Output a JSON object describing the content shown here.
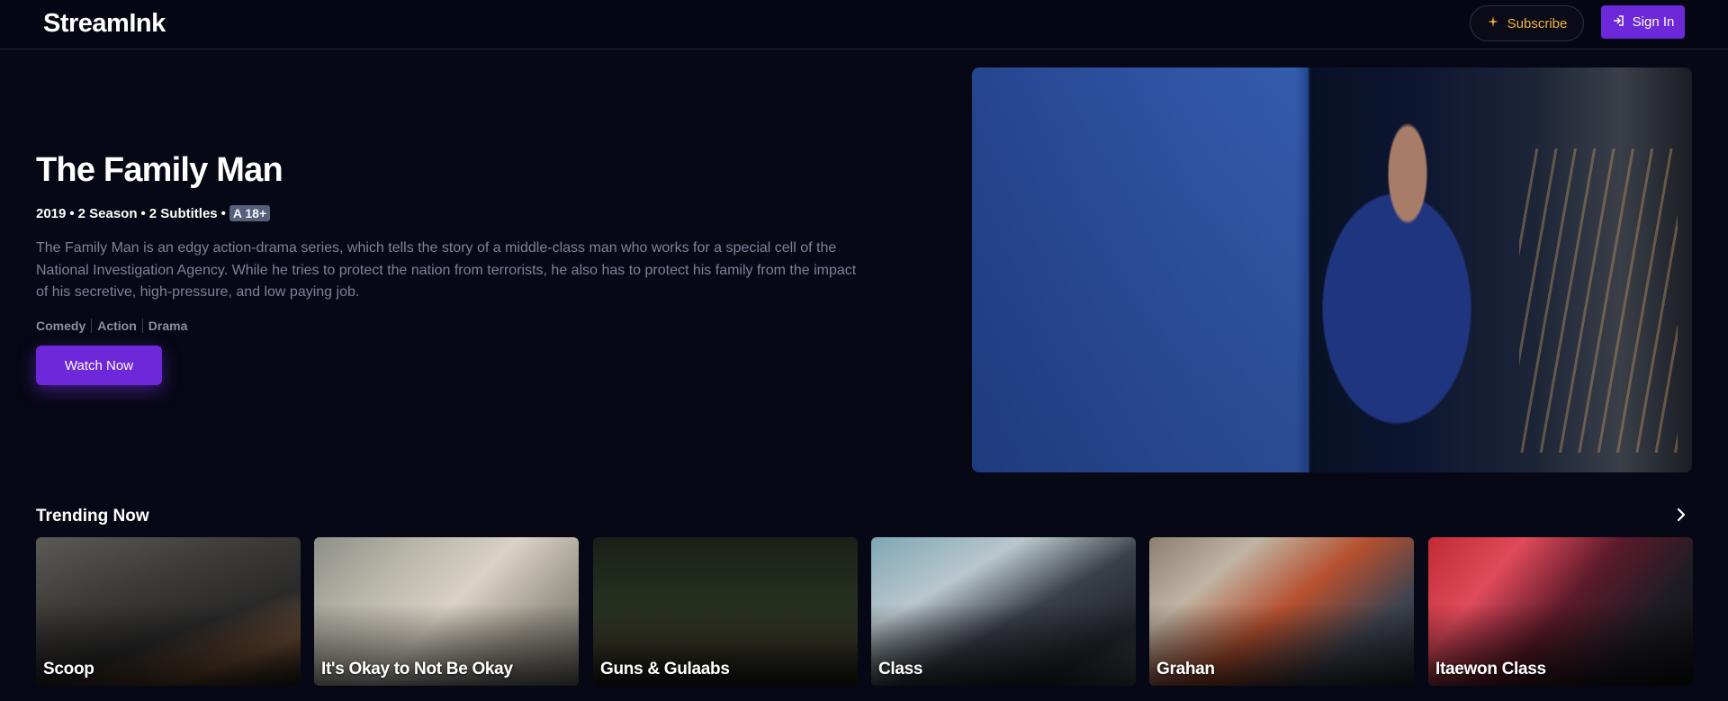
{
  "app": {
    "name": "StreamInk"
  },
  "header": {
    "subscribe_label": "Subscribe",
    "signin_label": "Sign In",
    "subscribe_icon": "sparkle-icon",
    "signin_icon": "sign-in-arrow-icon"
  },
  "hero": {
    "title": "The Family Man",
    "year": "2019",
    "seasons": "2 Season",
    "subtitles": "2 Subtitles",
    "rating": "A 18+",
    "description": "The Family Man is an edgy action-drama series, which tells the story of a middle-class man who works for a special cell of the National Investigation Agency. While he tries to protect the nation from terrorists, he also has to protect his family from the impact of his secretive, high-pressure, and low paying job.",
    "genres": [
      "Comedy",
      "Action",
      "Drama"
    ],
    "watch_label": "Watch Now"
  },
  "trending": {
    "title": "Trending Now",
    "next_icon": "chevron-right-icon",
    "items": [
      {
        "title": "Scoop"
      },
      {
        "title": "It's Okay to Not Be Okay"
      },
      {
        "title": "Guns & Gulaabs"
      },
      {
        "title": "Class"
      },
      {
        "title": "Grahan"
      },
      {
        "title": "Itaewon Class"
      }
    ]
  },
  "colors": {
    "background": "#070815",
    "accent": "#6d28d9",
    "subscribe_text": "#f0b53c",
    "muted_text": "#7d8297"
  }
}
